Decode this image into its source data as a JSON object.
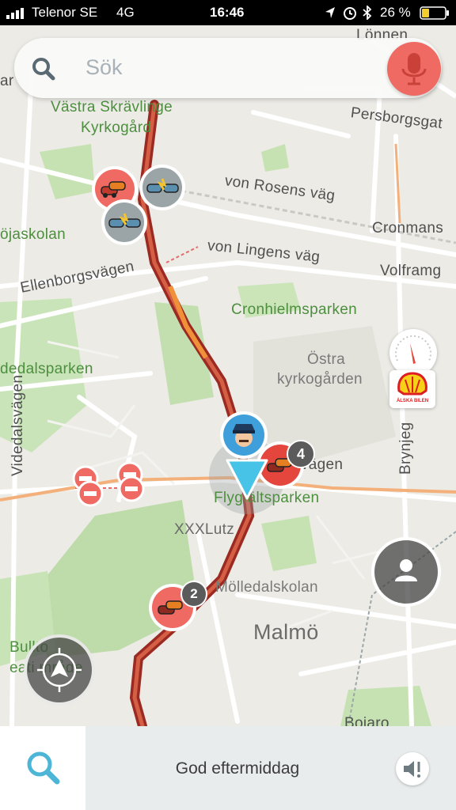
{
  "status_bar": {
    "carrier": "Telenor SE",
    "network": "4G",
    "time": "16:46",
    "battery": "26 %"
  },
  "search": {
    "placeholder": "Sök"
  },
  "map": {
    "labels": {
      "lonnen": "Lönnen",
      "vastra_skravlinge": "Västra Skrävlinge",
      "kyrkogard": "Kyrkogård",
      "persborgsgatan": "Persborgsgat",
      "von_rosens": "von Rosens väg",
      "cronmans": "Cronmans",
      "hojaskolan": "öjaskolan",
      "von_lingens": "von Lingens väg",
      "volframg": "Volframg",
      "ellenborgsvagen": "Ellenborgsvägen",
      "cronhielmsparken": "Cronhielmsparken",
      "ostra": "Östra",
      "kyrkogarden": "kyrkogården",
      "videdalsparken": "dedalsparken",
      "videdalsvagen": "Videdalsvägen",
      "brynjeg": "Brynjeg",
      "vagen": "vägen",
      "flygfaltsparken": "Flygfältsparken",
      "xxxlutz": "XXXLutz",
      "molledalskolan": "Mölledalskolan",
      "malmo": "Malmö",
      "bulltofta": "Bullto",
      "rekreationsomrade": "eati     mråde",
      "bottom_partial": "Bojaro",
      "left_edge": "ar"
    },
    "badges": {
      "jam_cluster_count": "4",
      "jam_south_count": "2"
    },
    "speed_gauge_icon": "speedometer-icon",
    "gas_station": {
      "brand_icon": "shell-logo",
      "caption": "ÄLSKA BILEN"
    }
  },
  "bottom_bar": {
    "greeting": "God eftermiddag"
  },
  "colors": {
    "traffic_red": "#b93d30",
    "traffic_orange": "#f08a3a",
    "park_green": "#b9dba4",
    "alert_red": "#ef6a63",
    "navigation_arrow": "#46c3e6"
  }
}
